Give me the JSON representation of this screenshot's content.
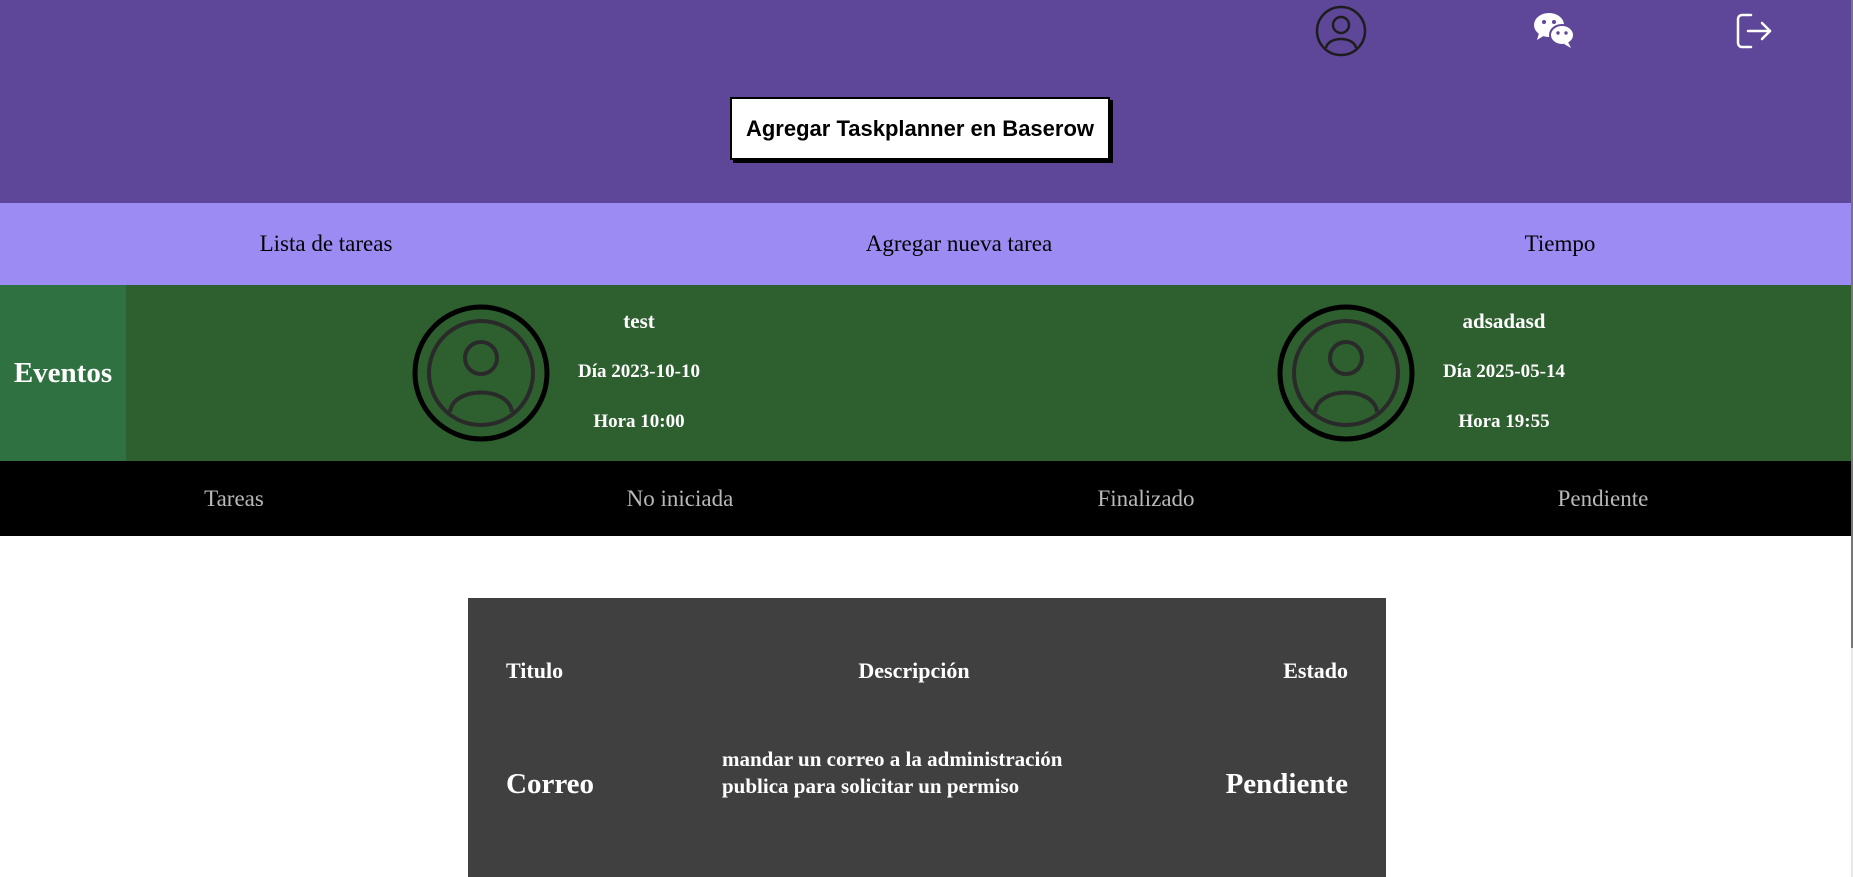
{
  "header": {
    "background": "#5e4699",
    "icons": {
      "profile": "user-circle-icon",
      "chat": "wechat-icon",
      "logout": "logout-icon"
    },
    "add_button_label": "Agregar Taskplanner en Baserow"
  },
  "nav": {
    "background": "#9c8bf3",
    "items": [
      {
        "label": "Lista de tareas"
      },
      {
        "label": "Agregar nueva tarea"
      },
      {
        "label": "Tiempo"
      }
    ]
  },
  "events": {
    "label": "Eventos",
    "background": "#2e5f2f",
    "items": [
      {
        "title": "test",
        "day": "Día 2023-10-10",
        "time": "Hora 10:00",
        "icon": "user-circle-icon"
      },
      {
        "title": "adsadasd",
        "day": "Día 2025-05-14",
        "time": "Hora 19:55",
        "icon": "user-circle-icon"
      }
    ]
  },
  "tabs": {
    "background": "#000000",
    "items": [
      {
        "label": "Tareas"
      },
      {
        "label": "No iniciada"
      },
      {
        "label": "Finalizado"
      },
      {
        "label": "Pendiente"
      }
    ]
  },
  "table": {
    "background": "#404040",
    "headers": {
      "title": "Titulo",
      "description": "Descripción",
      "status": "Estado"
    },
    "rows": [
      {
        "title": "Correo",
        "description": "mandar un correo a la administración publica para solicitar un permiso",
        "status": "Pendiente"
      }
    ]
  }
}
